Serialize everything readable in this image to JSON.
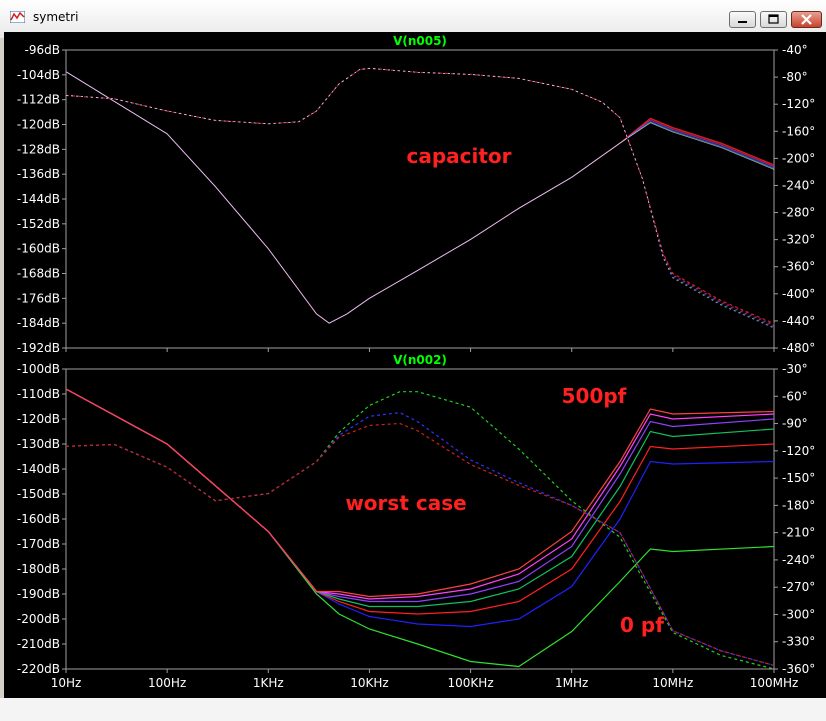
{
  "window": {
    "title": "symetri"
  },
  "icons": {
    "app": "waveform-icon",
    "minimize": "minimize-icon",
    "maximize": "maximize-icon",
    "close": "close-icon"
  },
  "colors": {
    "background": "#000000",
    "axis_text": "#ffffff",
    "trace_title": "#00ff00",
    "annotation": "#ff2020"
  },
  "chart_data": [
    {
      "type": "line",
      "title": "V(n005)",
      "x_scale": "log",
      "x_range_hz": [
        10,
        100000000
      ],
      "ylim": [
        -192,
        -96
      ],
      "ylim_right": [
        -480,
        -40
      ],
      "y_ticks": [
        "-96dB",
        "-104dB",
        "-112dB",
        "-120dB",
        "-128dB",
        "-136dB",
        "-144dB",
        "-152dB",
        "-160dB",
        "-168dB",
        "-176dB",
        "-184dB",
        "-192dB"
      ],
      "y_right_ticks": [
        "-40°",
        "-80°",
        "-120°",
        "-160°",
        "-200°",
        "-240°",
        "-280°",
        "-320°",
        "-360°",
        "-400°",
        "-440°",
        "-480°"
      ],
      "annotations": [
        "capacitor"
      ],
      "series": [
        {
          "kind": "magnitude",
          "x": [
            10,
            100,
            300,
            1000,
            3000,
            4000,
            6000,
            10000,
            30000,
            100000,
            300000,
            1000000,
            3000000,
            6000000,
            10000000,
            30000000,
            100000000
          ],
          "y": [
            -103,
            -123,
            -140,
            -160,
            -181,
            -184,
            -181,
            -176,
            -167,
            -157,
            -147,
            -137,
            -126,
            -118,
            -121,
            -126,
            -133
          ]
        },
        {
          "kind": "phase",
          "x": [
            10,
            30,
            100,
            300,
            1000,
            2000,
            3000,
            5000,
            8000,
            10000,
            30000,
            100000,
            300000,
            1000000,
            2000000,
            3000000,
            5000000,
            8000000,
            10000000,
            30000000,
            100000000
          ],
          "y": [
            -107,
            -112,
            -130,
            -144,
            -149,
            -146,
            -130,
            -90,
            -69,
            -67,
            -73,
            -76,
            -82,
            -98,
            -117,
            -140,
            -230,
            -340,
            -370,
            -410,
            -444
          ]
        }
      ]
    },
    {
      "type": "line",
      "title": "V(n002)",
      "x_scale": "log",
      "x_range_hz": [
        10,
        100000000
      ],
      "ylim": [
        -220,
        -100
      ],
      "ylim_right": [
        -360,
        -30
      ],
      "y_ticks": [
        "-100dB",
        "-110dB",
        "-120dB",
        "-130dB",
        "-140dB",
        "-150dB",
        "-160dB",
        "-170dB",
        "-180dB",
        "-190dB",
        "-200dB",
        "-210dB",
        "-220dB"
      ],
      "y_right_ticks": [
        "-30°",
        "-60°",
        "-90°",
        "-120°",
        "-150°",
        "-180°",
        "-210°",
        "-240°",
        "-270°",
        "-300°",
        "-330°",
        "-360°"
      ],
      "x_ticks": [
        "10Hz",
        "100Hz",
        "1KHz",
        "10KHz",
        "100KHz",
        "1MHz",
        "10MHz",
        "100MHz"
      ],
      "annotations": [
        "500pf",
        "worst case",
        "0 pf"
      ],
      "series": [
        {
          "kind": "magnitude",
          "x": [
            10,
            100,
            1000,
            3000,
            5000,
            10000,
            30000,
            100000,
            300000,
            1000000,
            3000000,
            6000000,
            10000000,
            100000000
          ],
          "y": [
            -108,
            -130,
            -165,
            -190,
            -198,
            -204,
            -210,
            -217,
            -219,
            -205,
            -185,
            -172,
            -173,
            -171
          ]
        },
        {
          "kind": "magnitude",
          "x": [
            10,
            100,
            1000,
            3000,
            5000,
            10000,
            30000,
            100000,
            300000,
            1000000,
            3000000,
            6000000,
            10000000,
            100000000
          ],
          "y": [
            -108,
            -130,
            -165,
            -189,
            -194,
            -199,
            -202,
            -203,
            -200,
            -187,
            -160,
            -137,
            -138,
            -137
          ]
        },
        {
          "kind": "magnitude",
          "x": [
            10,
            100,
            1000,
            3000,
            5000,
            10000,
            30000,
            100000,
            300000,
            1000000,
            3000000,
            6000000,
            10000000,
            100000000
          ],
          "y": [
            -108,
            -130,
            -165,
            -189,
            -193,
            -197,
            -198,
            -197,
            -193,
            -180,
            -153,
            -131,
            -132,
            -130
          ]
        },
        {
          "kind": "magnitude",
          "x": [
            10,
            100,
            1000,
            3000,
            5000,
            10000,
            30000,
            100000,
            300000,
            1000000,
            3000000,
            6000000,
            10000000,
            100000000
          ],
          "y": [
            -108,
            -130,
            -165,
            -189,
            -192,
            -195,
            -195,
            -193,
            -188,
            -175,
            -147,
            -125,
            -127,
            -124
          ]
        },
        {
          "kind": "magnitude",
          "x": [
            10,
            100,
            1000,
            3000,
            5000,
            10000,
            30000,
            100000,
            300000,
            1000000,
            3000000,
            6000000,
            10000000,
            100000000
          ],
          "y": [
            -108,
            -130,
            -165,
            -189,
            -191,
            -193,
            -193,
            -190,
            -185,
            -171,
            -142,
            -121,
            -123,
            -120
          ]
        },
        {
          "kind": "magnitude",
          "x": [
            10,
            100,
            1000,
            3000,
            5000,
            10000,
            30000,
            100000,
            300000,
            1000000,
            3000000,
            6000000,
            10000000,
            100000000
          ],
          "y": [
            -108,
            -130,
            -165,
            -189,
            -190,
            -192,
            -191,
            -188,
            -182,
            -168,
            -139,
            -118,
            -120,
            -118
          ]
        },
        {
          "kind": "magnitude",
          "x": [
            10,
            100,
            1000,
            3000,
            5000,
            10000,
            30000,
            100000,
            300000,
            1000000,
            3000000,
            6000000,
            10000000,
            100000000
          ],
          "y": [
            -108,
            -130,
            -165,
            -189,
            -189,
            -191,
            -190,
            -186,
            -180,
            -165,
            -137,
            -116,
            -118,
            -117
          ]
        },
        {
          "kind": "phase",
          "x": [
            10,
            30,
            100,
            300,
            1000,
            3000,
            5000,
            10000,
            20000,
            30000,
            100000,
            300000,
            1000000,
            3000000,
            5000000,
            10000000,
            30000000,
            100000000
          ],
          "y": [
            -115,
            -113,
            -138,
            -175,
            -167,
            -132,
            -100,
            -70,
            -55,
            -55,
            -72,
            -118,
            -175,
            -215,
            -260,
            -320,
            -345,
            -360
          ]
        },
        {
          "kind": "phase",
          "x": [
            10,
            30,
            100,
            300,
            1000,
            3000,
            5000,
            10000,
            20000,
            30000,
            100000,
            300000,
            1000000,
            3000000,
            5000000,
            10000000,
            30000000,
            100000000
          ],
          "y": [
            -115,
            -113,
            -138,
            -175,
            -167,
            -132,
            -103,
            -82,
            -78,
            -88,
            -130,
            -155,
            -180,
            -210,
            -255,
            -318,
            -340,
            -356
          ]
        },
        {
          "kind": "phase",
          "x": [
            10,
            30,
            100,
            300,
            1000,
            3000,
            5000,
            10000,
            20000,
            30000,
            100000,
            300000,
            1000000,
            3000000,
            5000000,
            10000000,
            30000000,
            100000000
          ],
          "y": [
            -115,
            -113,
            -138,
            -175,
            -167,
            -132,
            -105,
            -92,
            -90,
            -98,
            -135,
            -158,
            -180,
            -210,
            -255,
            -318,
            -340,
            -356
          ]
        }
      ]
    }
  ]
}
